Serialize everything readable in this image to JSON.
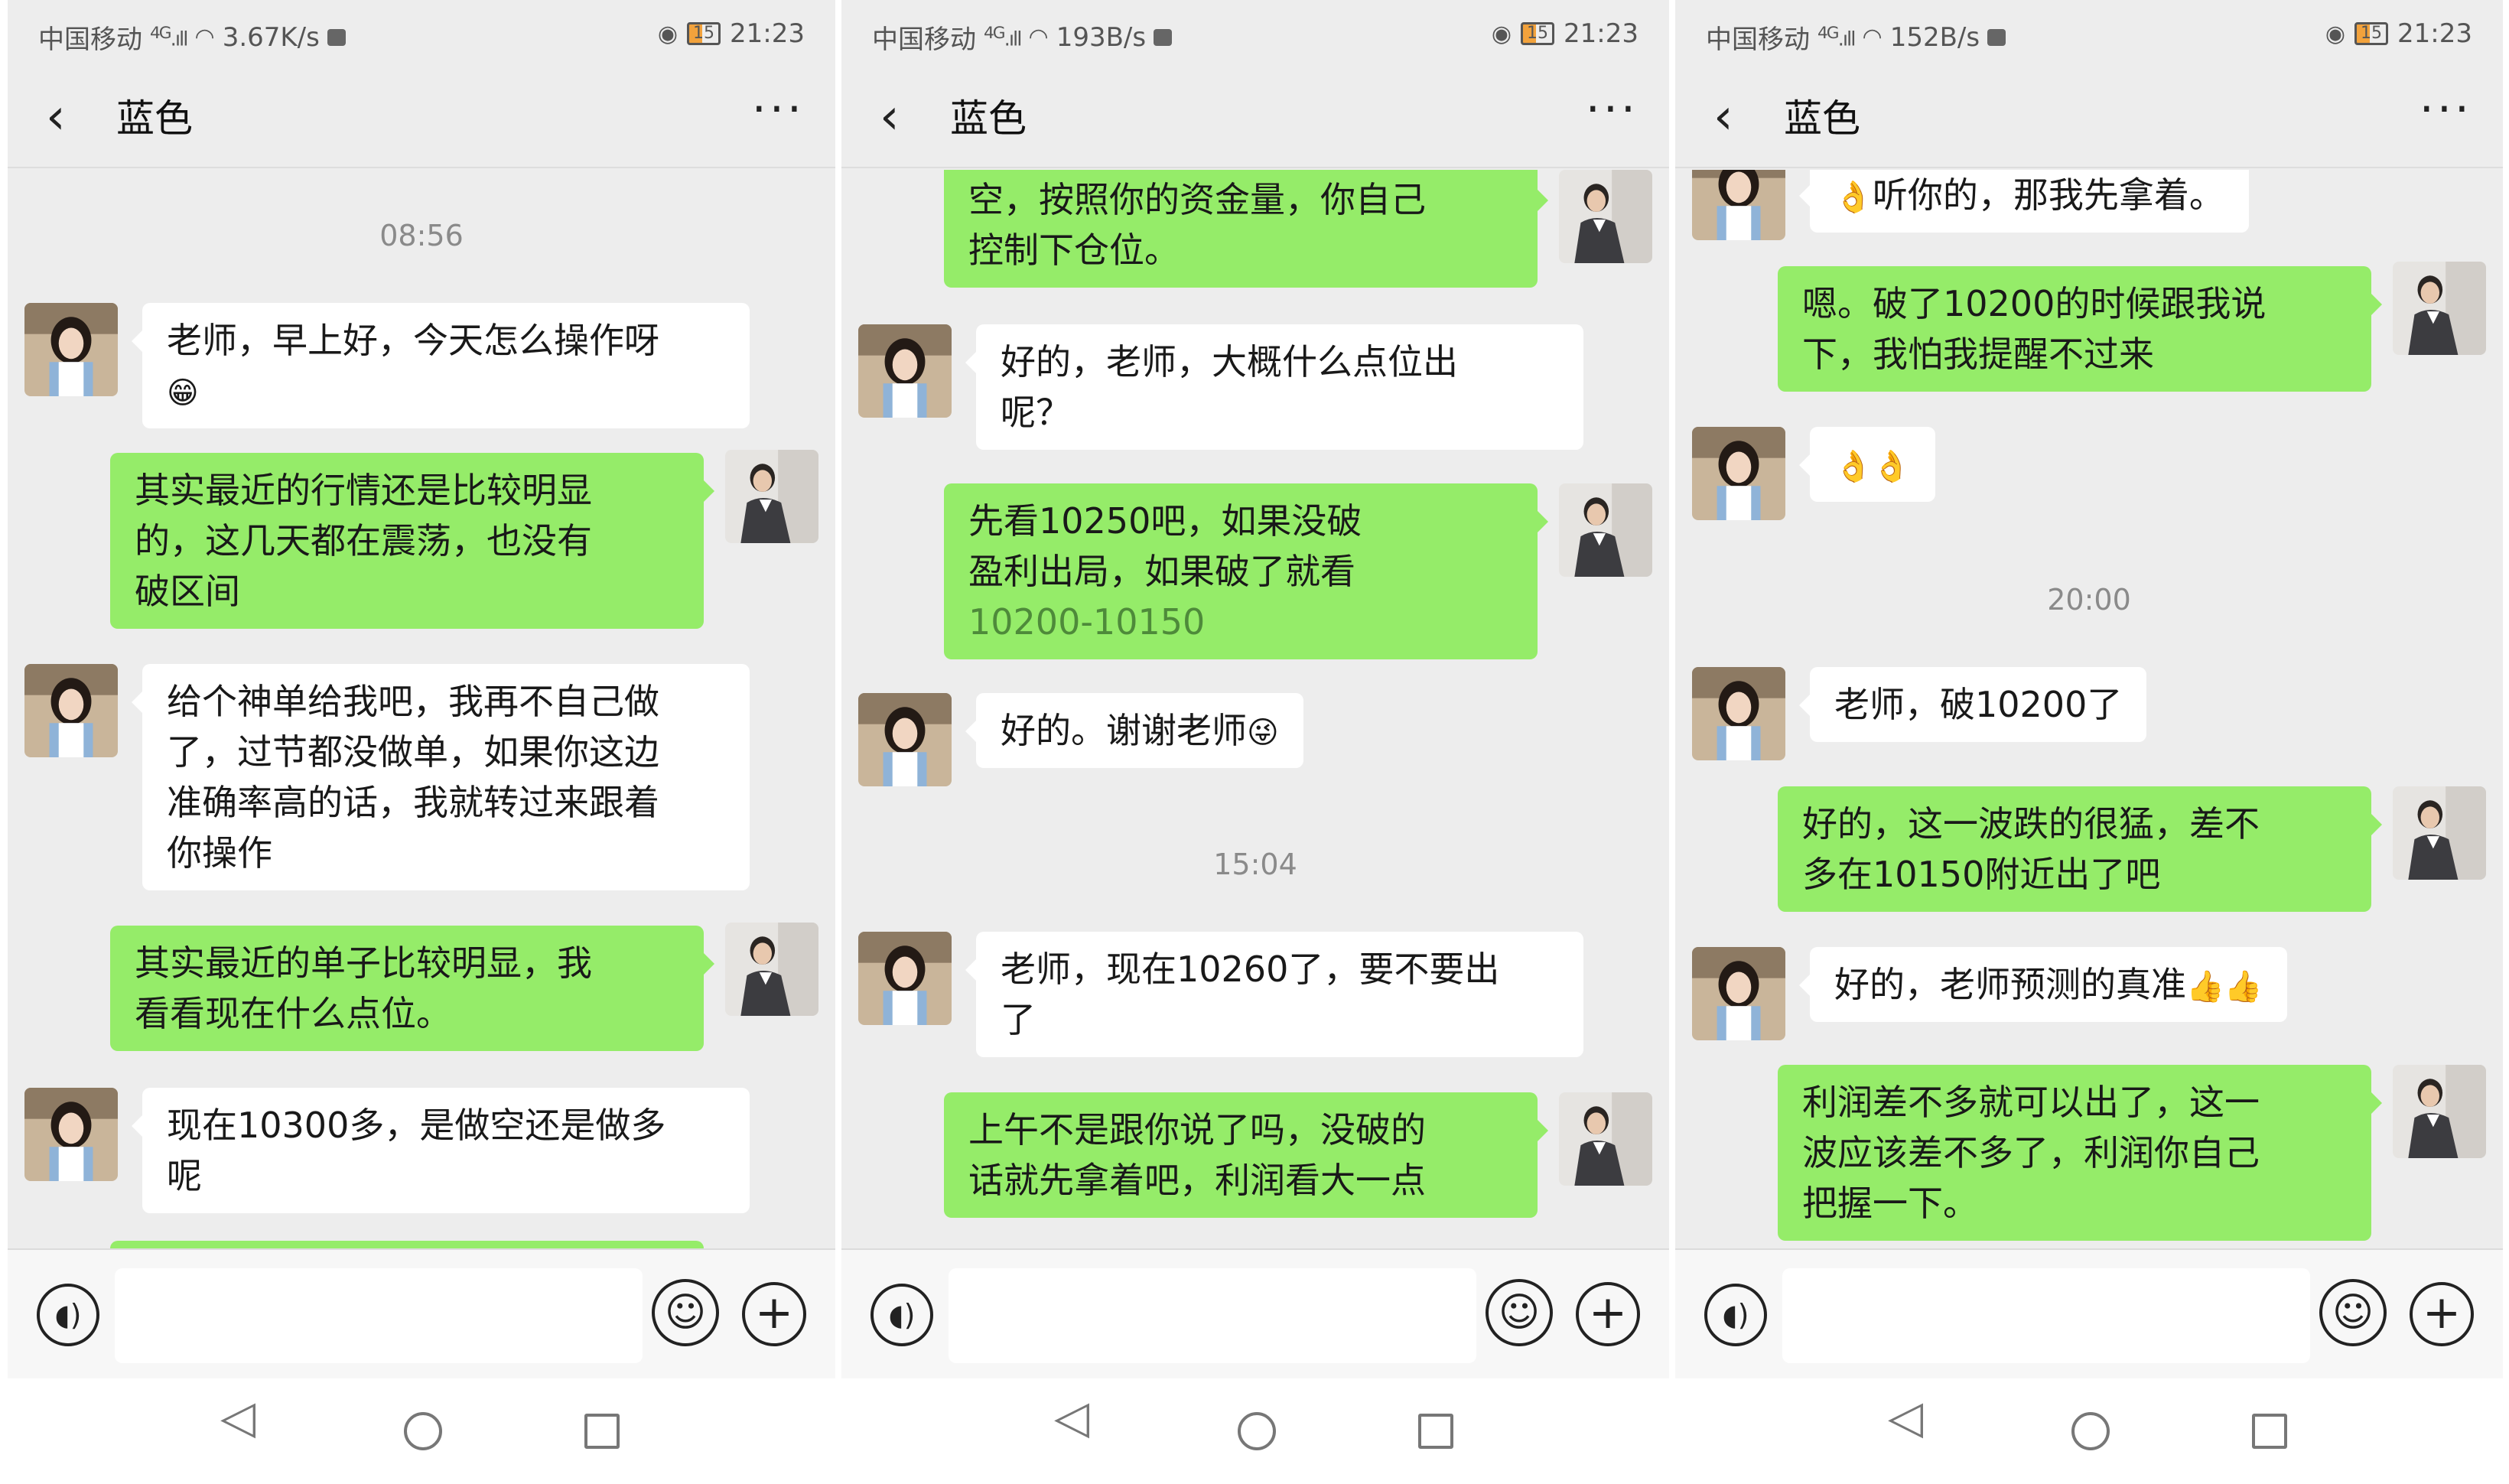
{
  "panels": [
    {
      "status": {
        "carrier": "中国移动",
        "net": "4G",
        "speed": "3.67K/s",
        "battery": "15",
        "time": "21:23"
      },
      "title": "蓝色",
      "messages": [
        {
          "kind": "timestamp",
          "text": "08:56"
        },
        {
          "kind": "in",
          "text": "老师，早上好，今天怎么操作呀",
          "emoji": "😁"
        },
        {
          "kind": "out",
          "text": "其实最近的行情还是比较明显\n的，这几天都在震荡，也没有\n破区间"
        },
        {
          "kind": "in",
          "text": "给个神单给我吧，我再不自己做\n了，过节都没做单，如果你这边\n准确率高的话，我就转过来跟着\n你操作"
        },
        {
          "kind": "out",
          "text": "其实最近的单子比较明显，我\n看看现在什么点位。"
        },
        {
          "kind": "in",
          "text": "现在10300多，是做空还是做多\n呢"
        }
      ]
    },
    {
      "status": {
        "carrier": "中国移动",
        "net": "4G",
        "speed": "193B/s",
        "battery": "15",
        "time": "21:23"
      },
      "title": "蓝色",
      "messages": [
        {
          "kind": "out",
          "text": "空，按照你的资金量，你自己\n控制下仓位。"
        },
        {
          "kind": "in",
          "text": "好的，老师，大概什么点位出\n呢？"
        },
        {
          "kind": "out",
          "text": "先看10250吧，如果没破\n盈利出局，如果破了就看",
          "highlight": "10200-10150"
        },
        {
          "kind": "in",
          "text": "好的。谢谢老师",
          "emoji": "😜"
        },
        {
          "kind": "timestamp",
          "text": "15:04"
        },
        {
          "kind": "in",
          "text": "老师，现在10260了，要不要出\n了"
        },
        {
          "kind": "out",
          "text": "上午不是跟你说了吗，没破的\n话就先拿着吧，利润看大一点"
        }
      ]
    },
    {
      "status": {
        "carrier": "中国移动",
        "net": "4G",
        "speed": "152B/s",
        "battery": "15",
        "time": "21:23"
      },
      "title": "蓝色",
      "messages": [
        {
          "kind": "in",
          "text": "听你的，那我先拿着。",
          "emoji_before": "👌"
        },
        {
          "kind": "out",
          "text": "嗯。破了10200的时候跟我说\n下，我怕我提醒不过来"
        },
        {
          "kind": "in",
          "text": "",
          "emoji": "👌👌"
        },
        {
          "kind": "timestamp",
          "text": "20:00"
        },
        {
          "kind": "in",
          "text": "老师，破10200了"
        },
        {
          "kind": "out",
          "text": "好的，这一波跌的很猛，差不\n多在10150附近出了吧"
        },
        {
          "kind": "in",
          "text": "好的，老师预测的真准",
          "emoji": "👍👍"
        },
        {
          "kind": "out",
          "text": "利润差不多就可以出了，这一\n波应该差不多了，利润你自己\n把握一下。"
        }
      ]
    }
  ],
  "icons": {
    "back": "chevron-left-icon",
    "more": "more-dots-icon",
    "voice": "voice-icon",
    "emoji": "emoji-icon",
    "plus": "plus-icon"
  },
  "colors": {
    "outgoing_bubble": "#95ec69",
    "incoming_bubble": "#ffffff",
    "background": "#ededed",
    "link": "#4e8a3a"
  }
}
